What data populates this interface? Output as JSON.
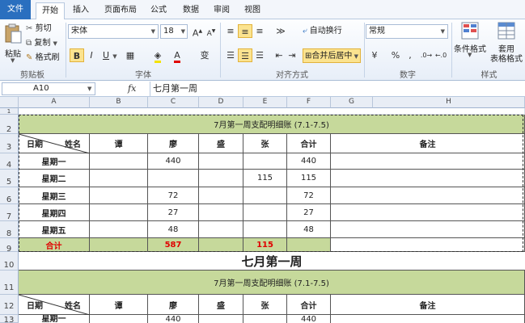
{
  "tabs": [
    "文件",
    "开始",
    "插入",
    "页面布局",
    "公式",
    "数据",
    "审阅",
    "视图"
  ],
  "clipboard": {
    "paste": "粘贴",
    "cut": "剪切",
    "copy": "复制",
    "format_painter": "格式刷",
    "label": "剪贴板"
  },
  "font": {
    "name": "宋体",
    "size": "18",
    "bold": "B",
    "italic": "I",
    "underline": "U",
    "label": "字体"
  },
  "alignment": {
    "wrap": "自动换行",
    "merge": "合并后居中",
    "label": "对齐方式"
  },
  "number": {
    "format": "常规",
    "percent": "%",
    "comma": ",",
    "label": "数字"
  },
  "styles": {
    "conditional": "条件格式",
    "table_l1": "套用",
    "table_l2": "表格格式",
    "label": "样式"
  },
  "formula_bar": {
    "name_box": "A10",
    "fx": "fx",
    "content": "七月第一周"
  },
  "columns": [
    "A",
    "B",
    "C",
    "D",
    "E",
    "F",
    "G",
    "H"
  ],
  "row_numbers": [
    "1",
    "2",
    "3",
    "4",
    "5",
    "6",
    "7",
    "8",
    "9",
    "10",
    "11",
    "12",
    "13"
  ],
  "table1": {
    "title": "7月第一周支配明细账 (7.1-7.5)",
    "header": {
      "date": "日期",
      "name": "姓名",
      "people": [
        "谭",
        "廖",
        "盛",
        "张"
      ],
      "total": "合计",
      "note": "备注"
    },
    "rows": [
      {
        "day": "星期一",
        "vals": [
          "",
          "440",
          "",
          ""
        ],
        "total": "440"
      },
      {
        "day": "星期二",
        "vals": [
          "",
          "",
          "",
          "115"
        ],
        "total": "115"
      },
      {
        "day": "星期三",
        "vals": [
          "",
          "72",
          "",
          ""
        ],
        "total": "72"
      },
      {
        "day": "星期四",
        "vals": [
          "",
          "27",
          "",
          ""
        ],
        "total": "27"
      },
      {
        "day": "星期五",
        "vals": [
          "",
          "48",
          "",
          ""
        ],
        "total": "48"
      }
    ],
    "sum": {
      "label": "合计",
      "vals": [
        "",
        "587",
        "",
        "115"
      ]
    }
  },
  "week_title": "七月第一周",
  "table2": {
    "title": "7月第一周支配明细账 (7.1-7.5)",
    "header": {
      "date": "日期",
      "name": "姓名",
      "people": [
        "谭",
        "廖",
        "盛",
        "张"
      ],
      "total": "合计",
      "note": "备注"
    },
    "rows": [
      {
        "day": "星期一",
        "vals": [
          "",
          "440",
          "",
          ""
        ],
        "total": "440"
      }
    ]
  }
}
